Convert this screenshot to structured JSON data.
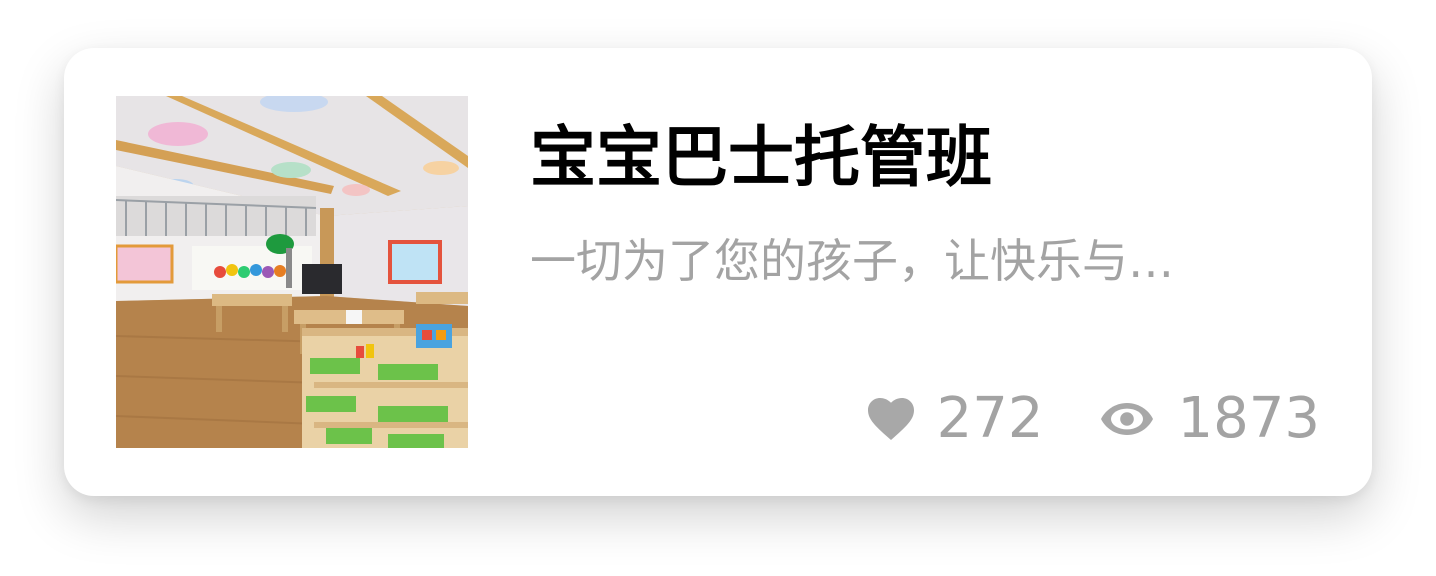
{
  "card": {
    "title": "宝宝巴士托管班",
    "description": "一切为了您的孩子，让快乐与…",
    "thumbnail_icon": "classroom-photo",
    "stats": {
      "likes": "272",
      "likes_icon": "heart-icon",
      "views": "1873",
      "views_icon": "eye-icon"
    }
  },
  "colors": {
    "title": "#000000",
    "muted": "#a3a3a3",
    "card_bg": "#ffffff"
  }
}
